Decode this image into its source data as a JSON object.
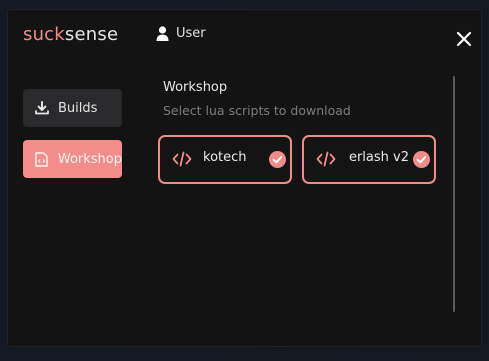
{
  "app": {
    "logo_part1": "suck",
    "logo_part2": "sense",
    "user_label": "User"
  },
  "sidebar": {
    "items": [
      {
        "label": "Builds",
        "icon": "download-icon",
        "active": false
      },
      {
        "label": "Workshop",
        "icon": "script-file-icon",
        "active": true
      }
    ]
  },
  "workshop": {
    "title": "Workshop",
    "subtitle": "Select lua scripts to download",
    "scripts": [
      {
        "name": "kotech",
        "icon": "code-icon",
        "selected": true
      },
      {
        "name": "erlash v2",
        "icon": "code-icon",
        "selected": true
      }
    ]
  },
  "colors": {
    "accent": "#f28d8a",
    "background": "#131314",
    "button": "#2a2a2d"
  }
}
